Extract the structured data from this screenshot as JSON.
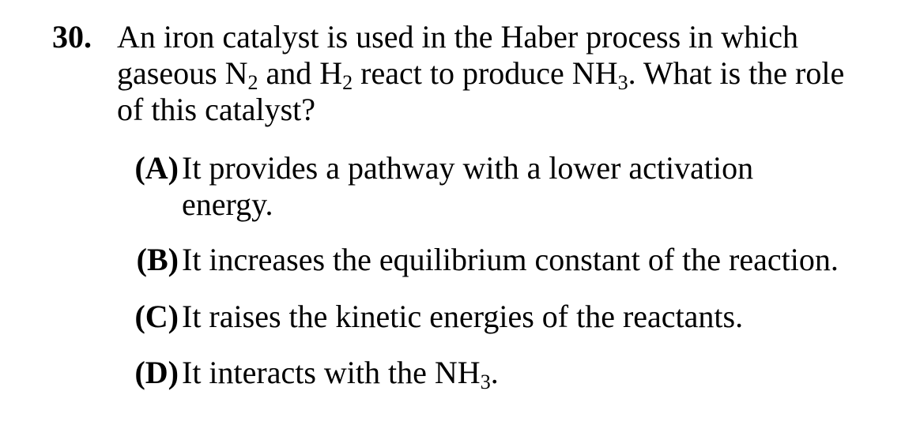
{
  "question": {
    "number": "30.",
    "stem": {
      "line1": "An iron catalyst is used in the Haber process in which",
      "line2_a": "gaseous N",
      "line2_sub1": "2",
      "line2_b": " and H",
      "line2_sub2": "2",
      "line2_c": " react to produce NH",
      "line2_sub3": "3",
      "line2_d": ". What is the role",
      "line3": "of this catalyst?"
    },
    "options": [
      {
        "letter": "(A)",
        "line1": "It provides a pathway with a lower activation",
        "line2": "energy."
      },
      {
        "letter": "(B)",
        "text": "It increases the equilibrium constant of the reaction."
      },
      {
        "letter": "(C)",
        "text": "It raises the kinetic energies of the reactants."
      },
      {
        "letter": "(D)",
        "text_a": "It interacts with the NH",
        "text_sub": "3",
        "text_b": "."
      }
    ]
  }
}
